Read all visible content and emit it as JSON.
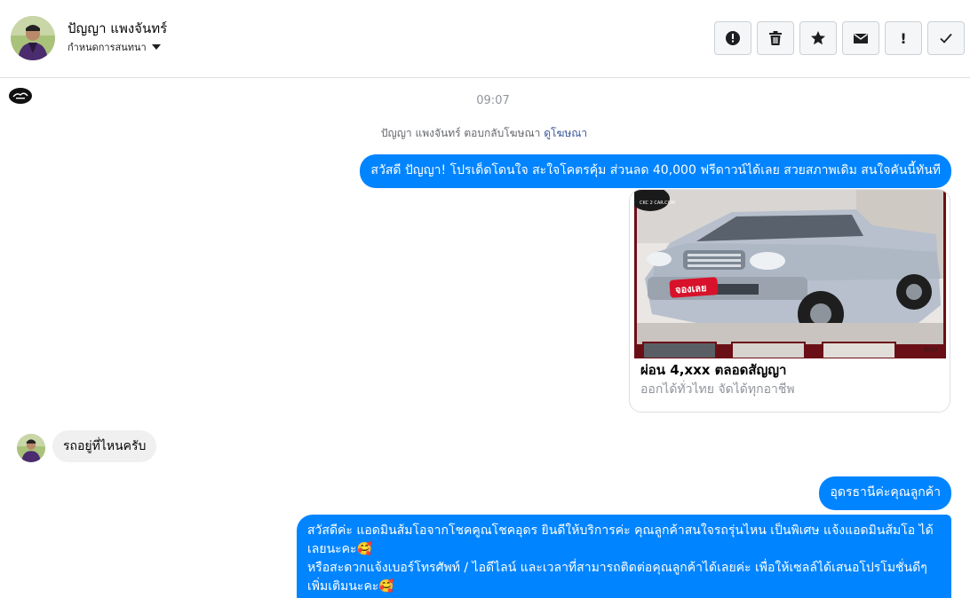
{
  "header": {
    "contact_name": "ปัญญา แพงจันทร์",
    "assign_label": "กำหนดการสนทนา",
    "actions": [
      {
        "name": "alert-button",
        "icon": "exclamation-circle-icon"
      },
      {
        "name": "delete-button",
        "icon": "trash-icon"
      },
      {
        "name": "star-button",
        "icon": "star-icon"
      },
      {
        "name": "mark-unread-button",
        "icon": "envelope-icon"
      },
      {
        "name": "spam-button",
        "icon": "exclamation-icon",
        "label": "!"
      },
      {
        "name": "done-button",
        "icon": "check-icon"
      }
    ]
  },
  "thread": {
    "time": "09:07",
    "reply_note": {
      "text": "ปัญญา แพงจันทร์ ตอบกลับโฆษณา",
      "link": "ดูโฆษณา"
    },
    "messages": [
      {
        "direction": "out",
        "text": "สวัสดี ปัญญา! โปรเด็ดโดนใจ สะใจโคตรคุ้ม ส่วนลด 40,000 ฟรีดาวน์ได้เลย สวยสภาพเดิม สนใจคันนี้ทันที"
      },
      {
        "direction": "out",
        "type": "card",
        "image_texts": {
          "watermark": "CKC 2 CAR.COM",
          "stamp": "จองเลย",
          "code": "K012"
        },
        "title": "ผ่อน 4,xxx ตลอดสัญญา",
        "subtitle": "ออกได้ทั่วไทย จัดได้ทุกอาชีพ"
      },
      {
        "direction": "in",
        "text": "รถอยู่ที่ไหนครับ"
      },
      {
        "direction": "out",
        "text": "อุดรธานีค่ะคุณลูกค้า"
      },
      {
        "direction": "out",
        "lines": [
          "สวัสดีค่ะ แอดมินส้มโอจากโชคคูณโชคอุดร ยินดีให้บริการค่ะ   คุณลูกค้าสนใจรถรุ่นไหน เป็นพิเศษ แจ้งแอดมินส้มโอ ได้เลยนะคะ🥰",
          "หรือสะดวกแจ้งเบอร์โทรศัพท์ / ไอดีไลน์ และเวลาที่สามารถติดต่อคุณลูกค้าได้เลยค่ะ เพื่อให้เซลล์ได้เสนอโปรโมชั่นดีๆเพิ่มเติมนะคะ🥰"
        ]
      }
    ]
  },
  "colors": {
    "accent": "#0084ff",
    "incoming_bubble": "#f0f0f0",
    "link": "#385898",
    "muted": "#90949c"
  }
}
